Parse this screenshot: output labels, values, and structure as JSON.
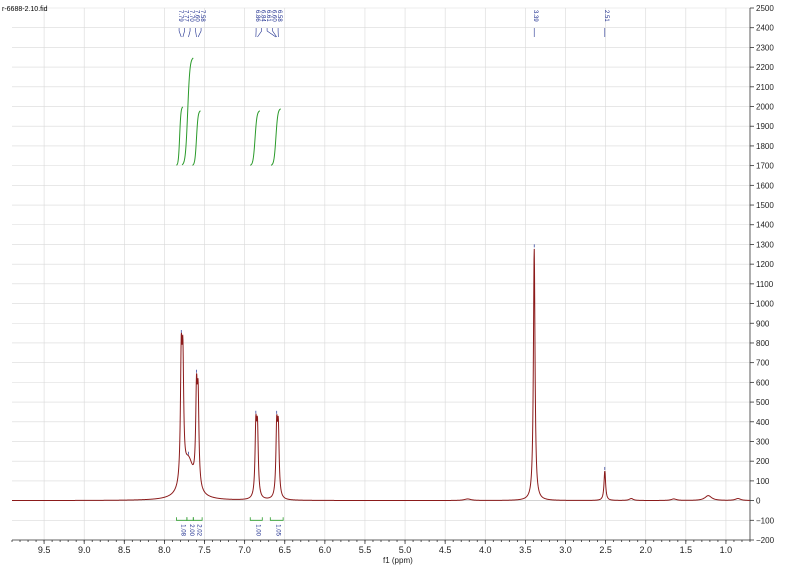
{
  "chart_data": {
    "type": "line",
    "title": "r-6688-2.10.fid",
    "xlabel": "f1 (ppm)",
    "ylabel": "",
    "xlim": [
      9.9,
      0.7
    ],
    "ylim": [
      -200,
      2500
    ],
    "x_reversed": true,
    "x_ticks": [
      "9.5",
      "9.0",
      "8.5",
      "8.0",
      "7.5",
      "7.0",
      "6.5",
      "6.0",
      "5.5",
      "5.0",
      "4.5",
      "4.0",
      "3.5",
      "3.0",
      "2.5",
      "2.0",
      "1.5",
      "1.0"
    ],
    "y_ticks": [
      "-200",
      "-100",
      "0",
      "100",
      "200",
      "300",
      "400",
      "500",
      "600",
      "700",
      "800",
      "900",
      "1000",
      "1100",
      "1200",
      "1300",
      "1400",
      "1500",
      "1600",
      "1700",
      "1800",
      "1900",
      "2000",
      "2100",
      "2200",
      "2300",
      "2400",
      "2500"
    ],
    "grid": true,
    "series": [
      {
        "peaks": [
          {
            "ppm": 7.79,
            "height": 610,
            "width": 0.012
          },
          {
            "ppm": 7.77,
            "height": 560,
            "width": 0.012
          },
          {
            "ppm": 7.7,
            "height": 190,
            "width": 0.08
          },
          {
            "ppm": 7.6,
            "height": 450,
            "width": 0.012
          },
          {
            "ppm": 7.58,
            "height": 430,
            "width": 0.012
          },
          {
            "ppm": 6.86,
            "height": 345,
            "width": 0.012
          },
          {
            "ppm": 6.84,
            "height": 330,
            "width": 0.012
          },
          {
            "ppm": 6.6,
            "height": 345,
            "width": 0.012
          },
          {
            "ppm": 6.58,
            "height": 330,
            "width": 0.012
          },
          {
            "ppm": 3.39,
            "height": 1280,
            "width": 0.012
          },
          {
            "ppm": 2.51,
            "height": 150,
            "width": 0.012
          },
          {
            "ppm": 4.22,
            "height": 8,
            "width": 0.05
          },
          {
            "ppm": 2.18,
            "height": 10,
            "width": 0.03
          },
          {
            "ppm": 1.65,
            "height": 8,
            "width": 0.04
          },
          {
            "ppm": 1.22,
            "height": 25,
            "width": 0.05
          },
          {
            "ppm": 0.85,
            "height": 10,
            "width": 0.04
          }
        ]
      }
    ],
    "peak_labels": [
      "7.79",
      "7.77",
      "7.70",
      "7.60",
      "7.58",
      "6.86",
      "6.84",
      "6.61",
      "6.60",
      "6.58",
      "3.39",
      "2.51"
    ],
    "integrations": [
      {
        "from": 7.85,
        "to": 7.72,
        "value": "1.08"
      },
      {
        "from": 7.72,
        "to": 7.64,
        "value": "2.00"
      },
      {
        "from": 7.64,
        "to": 7.53,
        "value": "2.02"
      },
      {
        "from": 6.93,
        "to": 6.78,
        "value": "1.00"
      },
      {
        "from": 6.68,
        "to": 6.52,
        "value": "1.05"
      }
    ],
    "integral_curves": [
      {
        "from": 7.85,
        "to": 7.77,
        "rise_min": 1700,
        "rise_max": 2000
      },
      {
        "from": 7.78,
        "to": 7.64,
        "rise_min": 1700,
        "rise_max": 2250
      },
      {
        "from": 7.65,
        "to": 7.55,
        "rise_min": 1700,
        "rise_max": 1980
      },
      {
        "from": 6.93,
        "to": 6.81,
        "rise_min": 1700,
        "rise_max": 1980
      },
      {
        "from": 6.67,
        "to": 6.55,
        "rise_min": 1700,
        "rise_max": 1990
      }
    ]
  },
  "colors": {
    "spectrum": "#8b1a1a",
    "integral": "#2a9a2a",
    "labels": "#1f2f8f"
  }
}
